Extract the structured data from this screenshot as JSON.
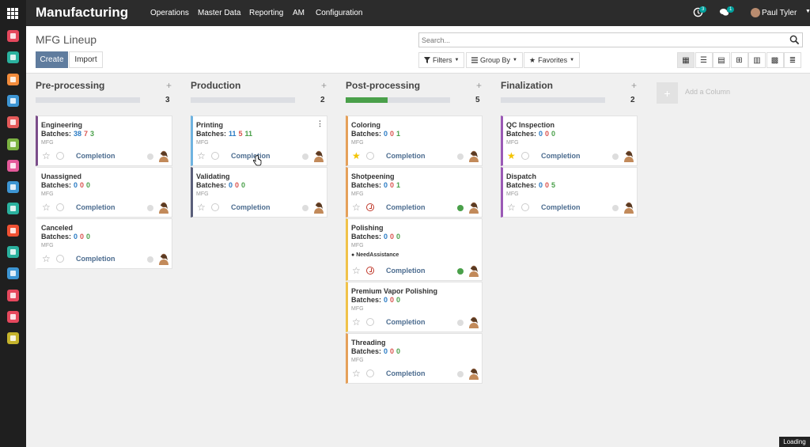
{
  "app": {
    "title": "Manufacturing"
  },
  "menu": [
    "Operations",
    "Master Data",
    "Reporting",
    "AM",
    "Configuration"
  ],
  "systray": {
    "activity_count": "3",
    "messages_count": "1",
    "user_name": "Paul Tyler"
  },
  "sidebar": {
    "apps": [
      {
        "icon": "discuss-icon",
        "color": "#e5485d"
      },
      {
        "icon": "notes-icon",
        "color": "#2ab19e"
      },
      {
        "icon": "sales-icon",
        "color": "#f28b3b"
      },
      {
        "icon": "invoicing-icon",
        "color": "#3d95d3"
      },
      {
        "icon": "inventory-icon",
        "color": "#e45a5a"
      },
      {
        "icon": "repair-icon",
        "color": "#7cb342"
      },
      {
        "icon": "purchase-icon",
        "color": "#e45a9a"
      },
      {
        "icon": "apps-store-icon",
        "color": "#3d95d3"
      },
      {
        "icon": "maintenance-icon",
        "color": "#2ab19e"
      },
      {
        "icon": "timesheet-icon",
        "color": "#f05133"
      },
      {
        "icon": "employees-icon",
        "color": "#2ab19e"
      },
      {
        "icon": "fleet-icon",
        "color": "#3d95d3"
      },
      {
        "icon": "dashboard-icon",
        "color": "#e5485d"
      },
      {
        "icon": "manufacturing-icon",
        "color": "#e5485d"
      },
      {
        "icon": "settings-icon",
        "color": "#c5b32c"
      }
    ]
  },
  "control": {
    "page_title": "MFG Lineup",
    "create_label": "Create",
    "import_label": "Import",
    "search_placeholder": "Search...",
    "filters_label": "Filters",
    "groupby_label": "Group By",
    "favorites_label": "Favorites",
    "views": [
      "kanban-view-icon",
      "list-view-icon",
      "calendar-view-icon",
      "pivot-view-icon",
      "graph-view-icon",
      "grid-view-icon",
      "activity-view-icon"
    ]
  },
  "columns": [
    {
      "name": "Pre-processing",
      "count": "3",
      "progress": 0,
      "cards": [
        {
          "name": "Engineering",
          "b": [
            "38",
            "7",
            "3"
          ],
          "tag": "MFG",
          "star": false,
          "clock": "none",
          "dot": "grey",
          "border": "#7b4d8a"
        },
        {
          "name": "Unassigned",
          "b": [
            "0",
            "0",
            "0"
          ],
          "tag": "MFG",
          "star": false,
          "clock": "none",
          "dot": "grey",
          "border": "transparent"
        },
        {
          "name": "Canceled",
          "b": [
            "0",
            "0",
            "0"
          ],
          "tag": "MFG",
          "star": false,
          "clock": "none",
          "dot": "grey",
          "border": "transparent"
        }
      ]
    },
    {
      "name": "Production",
      "count": "2",
      "progress": 0,
      "cards": [
        {
          "name": "Printing",
          "b": [
            "11",
            "5",
            "11"
          ],
          "tag": "MFG",
          "star": false,
          "clock": "none",
          "dot": "grey",
          "border": "#6fb3e0"
        },
        {
          "name": "Validating",
          "b": [
            "0",
            "0",
            "0"
          ],
          "tag": "MFG",
          "star": false,
          "clock": "none",
          "dot": "grey",
          "border": "#5a5f7a"
        }
      ]
    },
    {
      "name": "Post-processing",
      "count": "5",
      "progress": 0.4,
      "cards": [
        {
          "name": "Coloring",
          "b": [
            "0",
            "0",
            "1"
          ],
          "tag": "MFG",
          "star": true,
          "clock": "none",
          "dot": "grey",
          "border": "#e5a05a"
        },
        {
          "name": "Shotpeening",
          "b": [
            "0",
            "0",
            "1"
          ],
          "tag": "MFG",
          "star": false,
          "clock": "red",
          "dot": "green",
          "border": "#e5a05a"
        },
        {
          "name": "Polishing",
          "b": [
            "0",
            "0",
            "0"
          ],
          "tag": "MFG",
          "star": false,
          "clock": "red",
          "dot": "green",
          "border": "#f0c24a",
          "note": "NeedAssistance"
        },
        {
          "name": "Premium Vapor Polishing",
          "b": [
            "0",
            "0",
            "0"
          ],
          "tag": "MFG",
          "star": false,
          "clock": "none",
          "dot": "grey",
          "border": "#f0c24a"
        },
        {
          "name": "Threading",
          "b": [
            "0",
            "0",
            "0"
          ],
          "tag": "MFG",
          "star": false,
          "clock": "none",
          "dot": "grey",
          "border": "#e5a05a"
        }
      ]
    },
    {
      "name": "Finalization",
      "count": "2",
      "progress": 0,
      "cards": [
        {
          "name": "QC Inspection",
          "b": [
            "0",
            "0",
            "0"
          ],
          "tag": "MFG",
          "star": true,
          "clock": "none",
          "dot": "grey",
          "border": "#9b59b6"
        },
        {
          "name": "Dispatch",
          "b": [
            "0",
            "0",
            "5"
          ],
          "tag": "MFG",
          "star": false,
          "clock": "none",
          "dot": "grey",
          "border": "#9b59b6"
        }
      ]
    }
  ],
  "card_labels": {
    "batches": "Batches:",
    "completion": "Completion"
  },
  "add_column_label": "Add a Column",
  "loading_label": "Loading"
}
